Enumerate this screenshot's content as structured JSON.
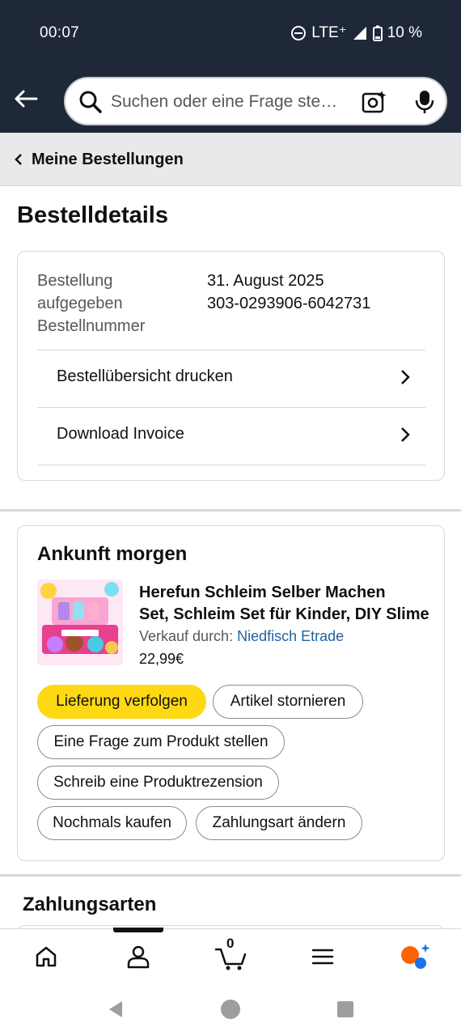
{
  "status_bar": {
    "time": "00:07",
    "network": "LTE⁺",
    "battery": "10 %"
  },
  "header": {
    "search_placeholder": "Suchen oder eine Frage ste…",
    "icons": [
      "back-arrow-icon",
      "search-icon",
      "camera-icon",
      "microphone-icon"
    ]
  },
  "breadcrumb": {
    "label": "Meine Bestellungen"
  },
  "page": {
    "title": "Bestelldetails"
  },
  "order_info": {
    "label_line1": "Bestellung",
    "label_line2": "aufgegeben",
    "label_line3": "Bestellnummer",
    "date": "31. August 2025",
    "order_number": "303-0293906-6042731",
    "actions": [
      {
        "label": "Bestellübersicht drucken"
      },
      {
        "label": "Download Invoice"
      }
    ]
  },
  "shipment": {
    "title": "Ankunft morgen",
    "product": {
      "name_line1": "Herefun Schleim Selber Machen",
      "name_line2": "Set, Schleim Set für Kinder, DIY Slime",
      "seller_prefix": "Verkauf durch: ",
      "seller_name": "Niedfisch Etrade",
      "price": "22,99€"
    },
    "buttons": {
      "track": "Lieferung verfolgen",
      "cancel": "Artikel stornieren",
      "question": "Eine Frage zum Produkt stellen",
      "review": "Schreib eine Produktrezension",
      "buy_again": "Nochmals kaufen",
      "payment": "Zahlungsart ändern"
    }
  },
  "payment": {
    "title": "Zahlungsarten"
  },
  "tabbar": {
    "cart_count": "0",
    "tabs": [
      "home-icon",
      "account-icon",
      "cart-icon",
      "menu-icon",
      "rufus-icon"
    ]
  },
  "colors": {
    "header_bg": "#1e2838",
    "primary_button": "#ffd814",
    "link": "#2162a1",
    "rufus_orange": "#ff6200",
    "rufus_blue": "#1a73e8"
  }
}
